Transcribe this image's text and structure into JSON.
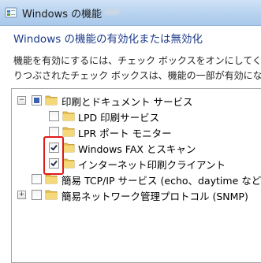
{
  "window": {
    "title": "Windows の機能"
  },
  "dialog": {
    "heading": "Windows の機能の有効化または無効化",
    "desc_line1": "機能を有効にするには、チェック ボックスをオンにしてくだ",
    "desc_line2": "りつぶされたチェック ボックスは、機能の一部が有効にな"
  },
  "tree": {
    "items": [
      {
        "label": "印刷とドキュメント サービス",
        "state": "partial"
      },
      {
        "label": "LPD 印刷サービス",
        "state": "unchecked"
      },
      {
        "label": "LPR ポート モニター",
        "state": "unchecked"
      },
      {
        "label": "Windows FAX とスキャン",
        "state": "checked"
      },
      {
        "label": "インターネット印刷クライアント",
        "state": "checked"
      },
      {
        "label": "簡易 TCP/IP サービス (echo、daytime など)",
        "state": "unchecked"
      },
      {
        "label": "簡易ネットワーク管理プロトコル (SNMP)",
        "state": "unchecked"
      }
    ]
  },
  "colors": {
    "highlight": "#e01818",
    "partial_fill": "#3a5fb3",
    "heading": "#1c3a8a"
  }
}
